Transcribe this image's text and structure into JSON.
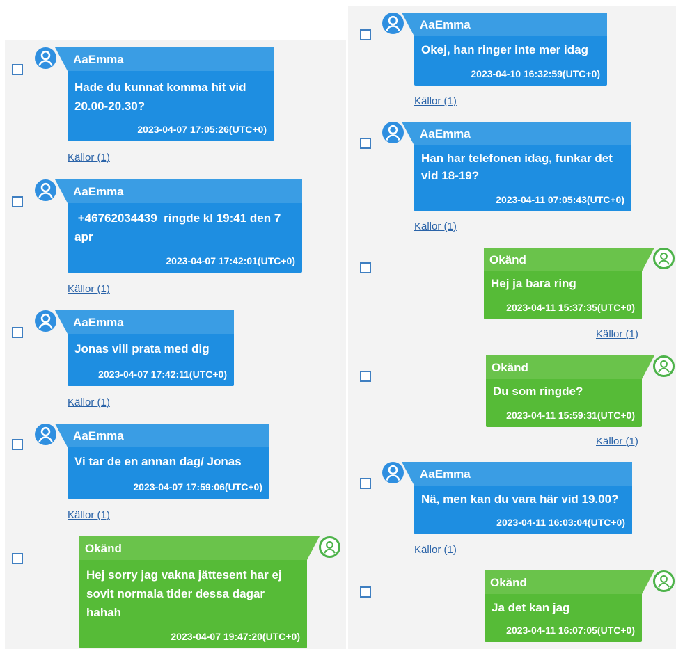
{
  "messages": [
    {
      "sender": "AaEmma",
      "side": "left",
      "text": "Hade du kunnat komma hit vid 20.00-20.30?",
      "timestamp": "2023-04-07 17:05:26(UTC+0)",
      "sources": "Källor (1)"
    },
    {
      "sender": "AaEmma",
      "side": "left",
      "text": " +46762034439  ringde kl 19:41 den 7 apr",
      "timestamp": "2023-04-07 17:42:01(UTC+0)",
      "sources": "Källor (1)"
    },
    {
      "sender": "AaEmma",
      "side": "left",
      "text": "Jonas vill prata med dig",
      "timestamp": "2023-04-07 17:42:11(UTC+0)",
      "sources": "Källor (1)"
    },
    {
      "sender": "AaEmma",
      "side": "left",
      "text": "Vi tar de en annan dag/ Jonas",
      "timestamp": "2023-04-07 17:59:06(UTC+0)",
      "sources": "Källor (1)"
    },
    {
      "sender": "Okänd",
      "side": "right",
      "text": "Hej sorry jag vakna jättesent har ej sovit normala tider dessa dagar hahah",
      "timestamp": "2023-04-07 19:47:20(UTC+0)",
      "sources": ""
    },
    {
      "sender": "AaEmma",
      "side": "left",
      "text": "Okej, han ringer inte mer idag",
      "timestamp": "2023-04-10 16:32:59(UTC+0)",
      "sources": "Källor (1)"
    },
    {
      "sender": "AaEmma",
      "side": "left",
      "text": "Han har telefonen idag, funkar det vid 18-19?",
      "timestamp": "2023-04-11 07:05:43(UTC+0)",
      "sources": "Källor (1)"
    },
    {
      "sender": "Okänd",
      "side": "right",
      "text": "Hej ja bara ring",
      "timestamp": "2023-04-11 15:37:35(UTC+0)",
      "sources": "Källor (1)"
    },
    {
      "sender": "Okänd",
      "side": "right",
      "text": "Du som ringde?",
      "timestamp": "2023-04-11 15:59:31(UTC+0)",
      "sources": "Källor (1)"
    },
    {
      "sender": "AaEmma",
      "side": "left",
      "text": "Nä, men kan du vara här vid 19.00?",
      "timestamp": "2023-04-11 16:03:04(UTC+0)",
      "sources": "Källor (1)"
    },
    {
      "sender": "Okänd",
      "side": "right",
      "text": "Ja det kan jag",
      "timestamp": "2023-04-11 16:07:05(UTC+0)",
      "sources": ""
    }
  ],
  "colors": {
    "incoming": "#1e8ee1",
    "outgoing": "#56bb37",
    "link": "#2a63a8"
  },
  "icons": {
    "sender_avatar": "user-avatar-icon",
    "checkbox": "checkbox"
  }
}
